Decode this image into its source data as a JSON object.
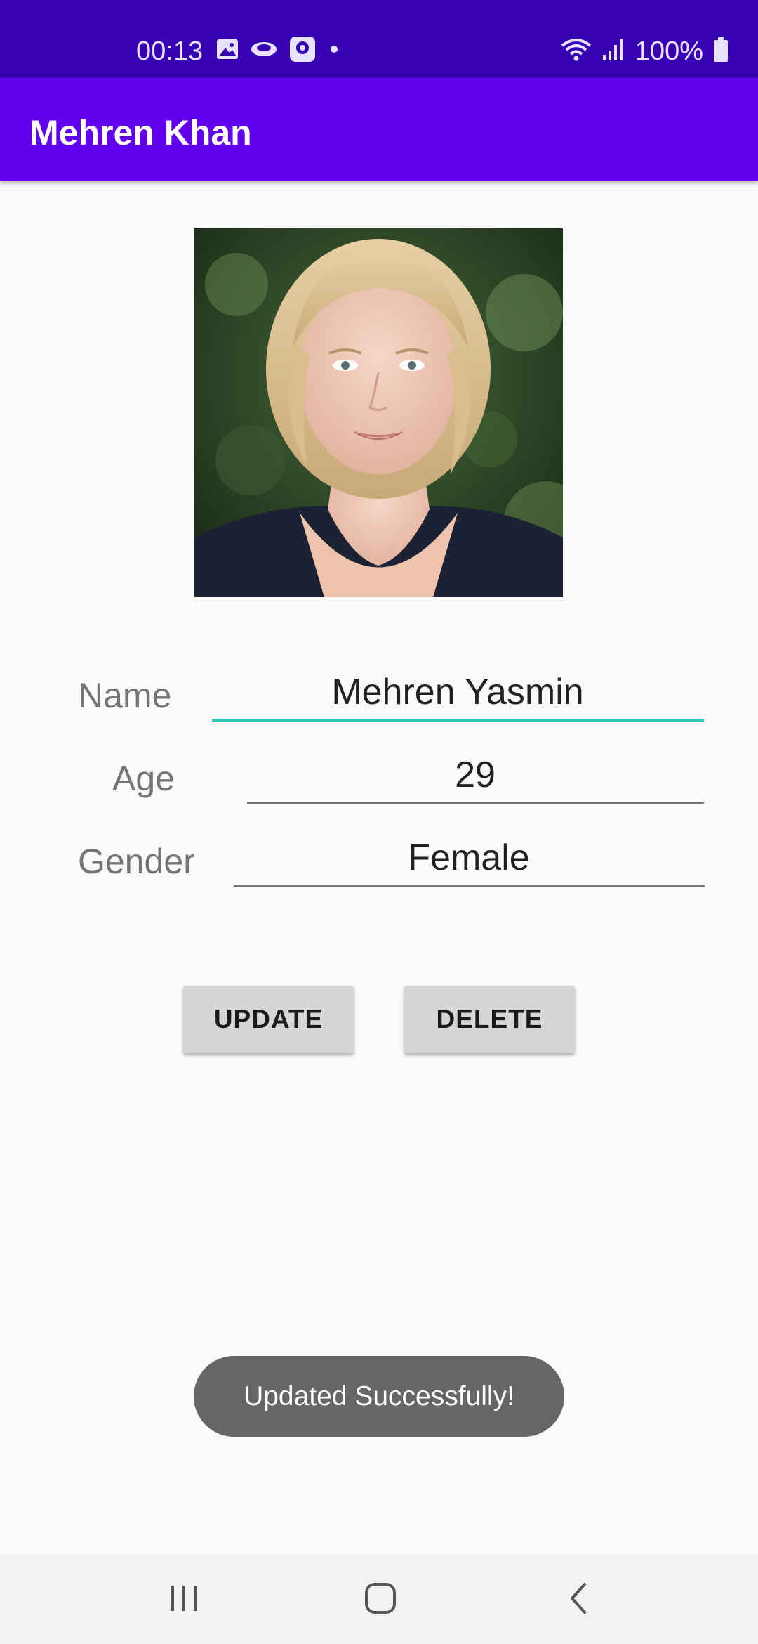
{
  "status_bar": {
    "time": "00:13",
    "battery": "100%",
    "left_icons": [
      "gallery-icon",
      "cloud-icon",
      "bixby-icon",
      "dot-icon"
    ],
    "right_icons": [
      "wifi-icon",
      "signal-icon",
      "battery-icon"
    ]
  },
  "app_bar": {
    "title": "Mehren Khan",
    "color": "#6200ee"
  },
  "form": {
    "name_label": "Name",
    "name_value": "Mehren Yasmin",
    "age_label": "Age",
    "age_value": "29",
    "gender_label": "Gender",
    "gender_value": "Female"
  },
  "buttons": {
    "update_label": "UPDATE",
    "delete_label": "DELETE"
  },
  "toast": {
    "message": "Updated Successfully!"
  },
  "nav_bar": {
    "icons": [
      "recents-icon",
      "home-icon",
      "back-icon"
    ]
  },
  "colors": {
    "status_bar": "#3700b3",
    "app_bar": "#6200ee",
    "focus_underline": "#2ec4b6"
  }
}
